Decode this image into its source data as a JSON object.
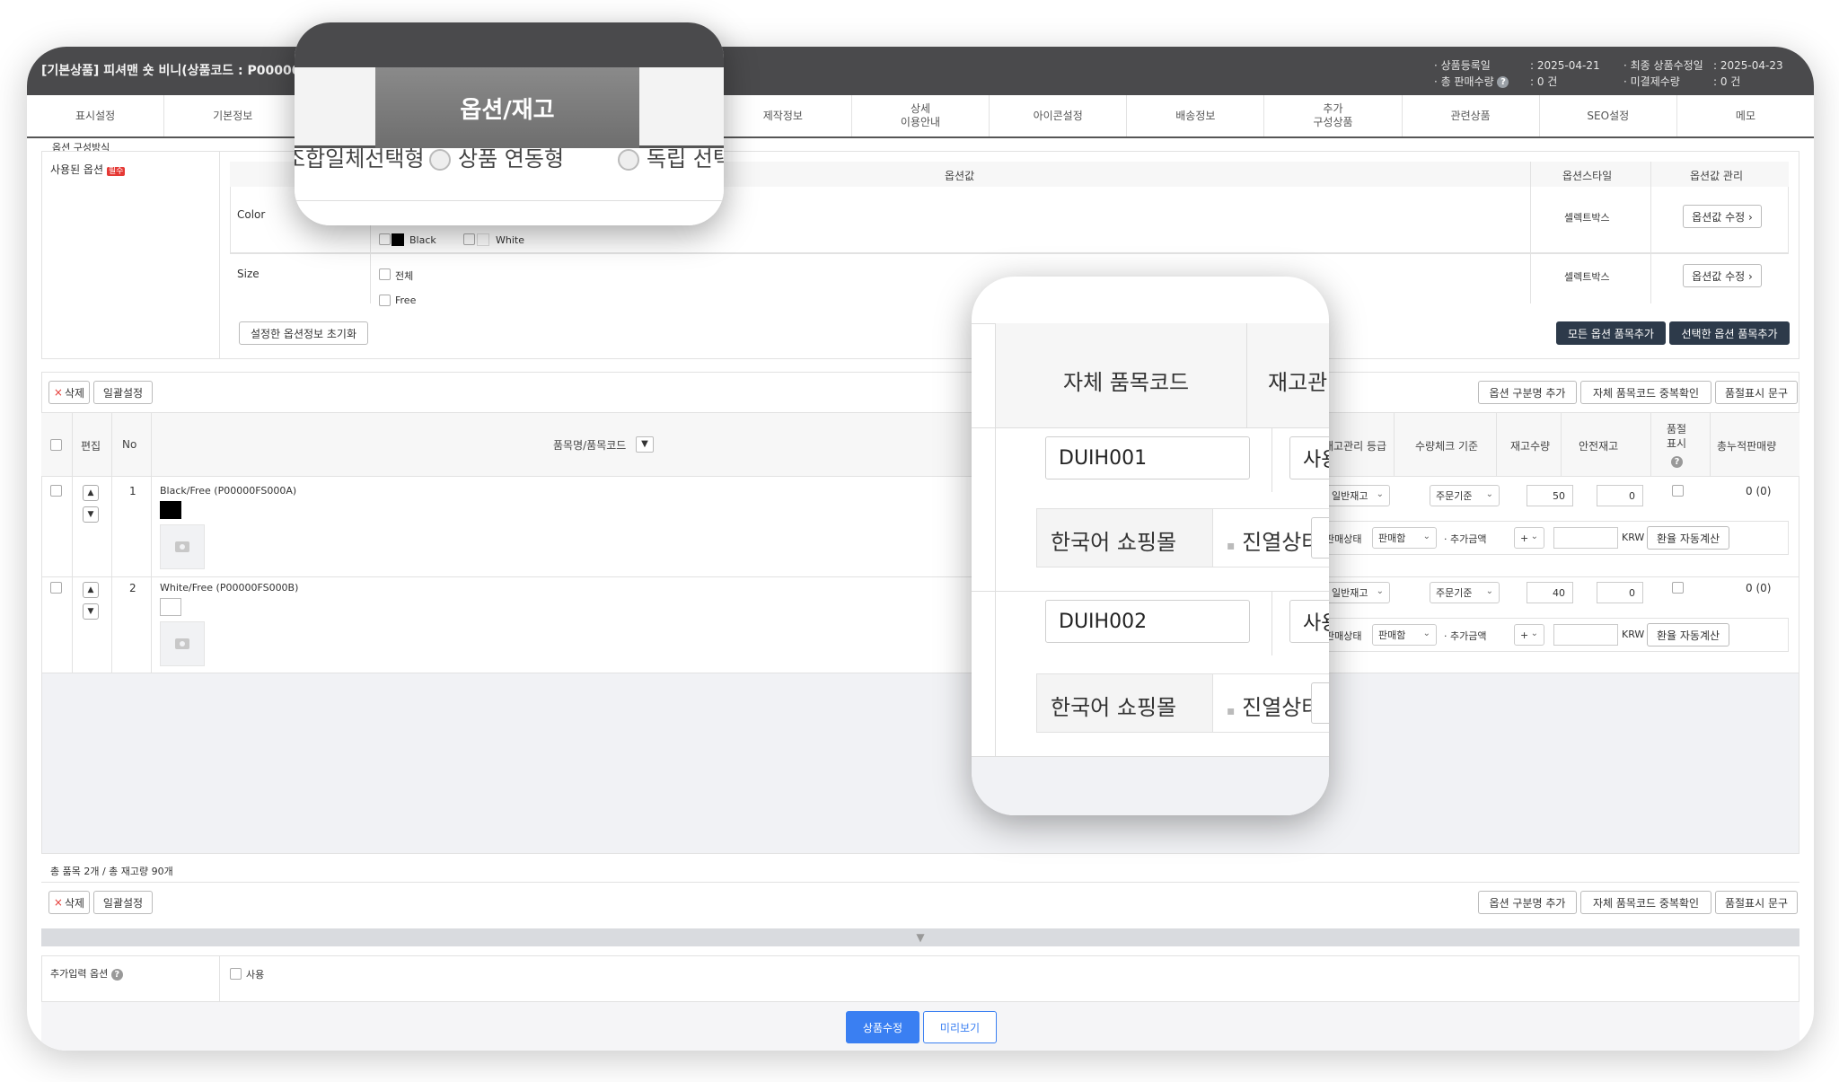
{
  "header": {
    "title": "[기본상품] 피셔맨 숏 비니(상품코드 : P00000FS)",
    "meta1": {
      "label_a": "· 상품등록일",
      "label_b": "· 총 판매수량",
      "value_a": ": 2025-04-21",
      "value_b": ": 0 건"
    },
    "meta2": {
      "label_a": "· 최종 상품수정일",
      "label_b": "· 미결제수량",
      "value_a": ": 2025-04-23",
      "value_b": ": 0 건"
    }
  },
  "tabs": [
    "표시설정",
    "기본정보",
    "",
    "",
    "",
    "제작정보",
    "상세\n이용안내",
    "아이콘설정",
    "배송정보",
    "추가\n구성상품",
    "관련상품",
    "SEO설정",
    "메모"
  ],
  "option_settings": {
    "used_options_label": "사용된 옵션",
    "required_badge": "필수",
    "composition_label": "옵션 구성방식",
    "table_headers": {
      "option_value": "옵션값",
      "option_style": "옵션스타일",
      "option_manage": "옵션값 관리"
    },
    "options": [
      {
        "name": "Color",
        "values": [
          "Black",
          "White"
        ],
        "style": "셀렉트박스",
        "edit_button": "옵션값 수정 ›"
      },
      {
        "name": "Size",
        "values": [
          "전체",
          "Free"
        ],
        "style": "셀렉트박스",
        "edit_button": "옵션값 수정 ›"
      }
    ],
    "reset_button": "설정한 옵션정보 초기화",
    "add_all_button": "모든 옵션 품목추가",
    "add_selected_button": "선택한 옵션 품목추가"
  },
  "items_toolbar": {
    "delete_button": "삭제",
    "bulk_button": "일괄설정",
    "add_option_name_button": "옵션 구분명 추가",
    "dup_check_button": "자체 품목코드 중복확인",
    "soldout_text_button": "품절표시 문구"
  },
  "items_table": {
    "headers": {
      "edit": "편집",
      "no": "No",
      "name": "품목명/품목코드",
      "stock_grade": "재고관리 등급",
      "qty_check": "수량체크 기준",
      "stock_qty": "재고수량",
      "safety_stock": "안전재고",
      "soldout_display": "품절\n표시",
      "total_sales": "총누적판매량"
    },
    "rows": [
      {
        "no": "1",
        "name": "Black/Free (P00000FS000A)",
        "swatch": "#000000",
        "stock_grade": "일반재고",
        "qty_check": "주문기준",
        "stock_qty": "50",
        "safety_stock": "0",
        "total_sales": "0 (0)",
        "sale_status_label": "판매상태",
        "sale_status": "판매함",
        "extra_price_label": "추가금액",
        "sign": "+",
        "currency": "KRW",
        "fx_button": "환율 자동계산"
      },
      {
        "no": "2",
        "name": "White/Free (P00000FS000B)",
        "swatch": "#ffffff",
        "stock_grade": "일반재고",
        "qty_check": "주문기준",
        "stock_qty": "40",
        "safety_stock": "0",
        "total_sales": "0 (0)",
        "sale_status_label": "판매상태",
        "sale_status": "판매함",
        "extra_price_label": "추가금액",
        "sign": "+",
        "currency": "KRW",
        "fx_button": "환율 자동계산"
      }
    ],
    "summary": "총 품목 2개 / 총 재고량 90개"
  },
  "extra_input": {
    "label": "추가입력 옵션",
    "checkbox_label": "사용"
  },
  "footer": {
    "save_button": "상품수정",
    "preview_button": "미리보기"
  },
  "zoom_tab": {
    "active_tab": "옵션/재고",
    "radio_1": "조합일체선택형",
    "radio_2": "상품 연동형",
    "radio_3": "독립 선택형"
  },
  "zoom_items": {
    "header_code": "자체 품목코드",
    "header_stock": "재고관리",
    "rows": [
      {
        "code": "DUIH001",
        "use": "사용",
        "mall": "한국어 쇼핑몰",
        "display": "진열상태"
      },
      {
        "code": "DUIH002",
        "use": "사용",
        "mall": "한국어 쇼핑몰",
        "display": "진열상태"
      }
    ]
  },
  "colors": {
    "header_bg": "#4a4a4c",
    "primary": "#3a7ff2",
    "dark_button": "#2d3a4a",
    "required_badge": "#e53935"
  }
}
